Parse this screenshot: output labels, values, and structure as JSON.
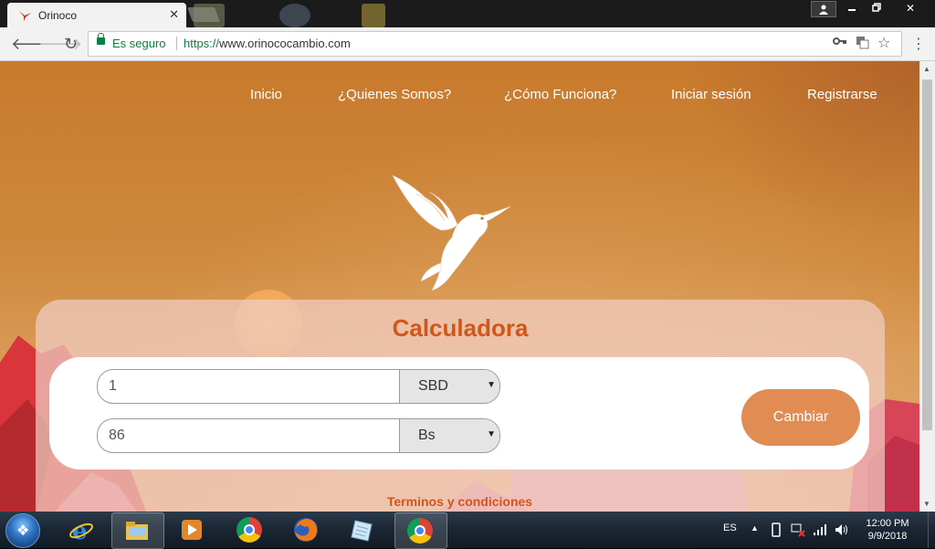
{
  "browser": {
    "tab_title": "Orinoco",
    "tab_close": "✕",
    "secure_label": "Es seguro",
    "url_protocol": "https://",
    "url_host": "www.orinococambio.com",
    "window_close": "✕"
  },
  "nav": {
    "items": [
      {
        "label": "Inicio"
      },
      {
        "label": "¿Quienes Somos?"
      },
      {
        "label": "¿Cómo Funciona?"
      },
      {
        "label": "Iniciar sesión"
      },
      {
        "label": "Registrarse"
      }
    ]
  },
  "calculator": {
    "title": "Calculadora",
    "amount_from": "1",
    "currency_from": "SBD",
    "amount_to": "86",
    "currency_to": "Bs",
    "button_label": "Cambiar"
  },
  "footer": {
    "terms_link": "Terminos y condiciones"
  },
  "taskbar": {
    "language": "ES",
    "time": "12:00 PM",
    "date": "9/9/2018"
  },
  "colors": {
    "accent": "#d2561a",
    "button": "#e08c52",
    "secure": "#0b8043"
  }
}
